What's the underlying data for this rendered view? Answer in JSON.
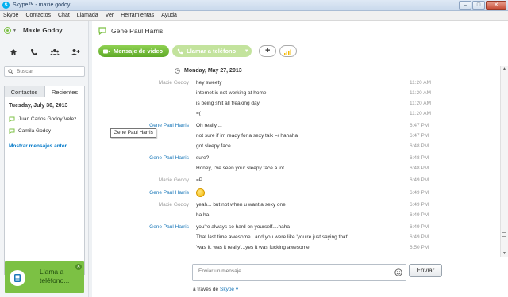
{
  "window": {
    "title": "Skype™ - maxie.godoy",
    "controls": [
      "minimize",
      "maximize",
      "close"
    ]
  },
  "menu": [
    "Skype",
    "Contactos",
    "Chat",
    "Llamada",
    "Ver",
    "Herramientas",
    "Ayuda"
  ],
  "sidebar": {
    "profile_name": "Maxie Godoy",
    "search_placeholder": "Buscar",
    "tabs": [
      {
        "label": "Contactos",
        "active": false
      },
      {
        "label": "Recientes",
        "active": true
      }
    ],
    "recent_date": "Tuesday, July 30, 2013",
    "recent_items": [
      {
        "name": "Juan Carlos Godoy Velez"
      },
      {
        "name": "Camila Godoy"
      }
    ],
    "more_link": "Mostrar mensajes anter...",
    "call_banner": {
      "label_line1": "Llama a",
      "label_line2": "teléfono..."
    }
  },
  "conversation": {
    "title": "Gene Paul Harris",
    "video_button": "Mensaje de video",
    "call_button": "Llamar a teléfono",
    "date_header": "Monday, May 27, 2013",
    "tooltip": "Gene Paul Harris",
    "messages": [
      {
        "sender": "Maxie Godoy",
        "sender_style": "gray",
        "text": "hey sweety",
        "time": "11:20 AM"
      },
      {
        "sender": "",
        "sender_style": "gray",
        "text": "internet is not working at home",
        "time": "11:20 AM"
      },
      {
        "sender": "",
        "sender_style": "gray",
        "text": "is being shit all freaking day",
        "time": "11:20 AM"
      },
      {
        "sender": "",
        "sender_style": "gray",
        "text": "=(",
        "time": "11:20 AM"
      },
      {
        "sender": "Gene Paul Harris",
        "sender_style": "blue",
        "text": "Oh really....",
        "time": "6:47 PM"
      },
      {
        "sender": "",
        "sender_style": "gray",
        "text": "not sure if im ready for a sexy talk =/ hahaha",
        "time": "6:47 PM"
      },
      {
        "sender": "",
        "sender_style": "gray",
        "text": "got sleepy face",
        "time": "6:48 PM"
      },
      {
        "sender": "Gene Paul Harris",
        "sender_style": "blue",
        "text": "sure?",
        "time": "6:48 PM"
      },
      {
        "sender": "",
        "sender_style": "gray",
        "text": "Honey, I've seen your sleepy face a lot",
        "time": "6:48 PM"
      },
      {
        "sender": "Maxie Godoy",
        "sender_style": "gray",
        "text": "=P",
        "time": "6:49 PM"
      },
      {
        "sender": "Gene Paul Harris",
        "sender_style": "blue",
        "text": "",
        "emoticon": "smile",
        "time": "6:49 PM"
      },
      {
        "sender": "Maxie Godoy",
        "sender_style": "gray",
        "text": "yeah... but not when u want a sexy one",
        "time": "6:49 PM"
      },
      {
        "sender": "",
        "sender_style": "gray",
        "text": "ha ha",
        "time": "6:49 PM"
      },
      {
        "sender": "Gene Paul Harris",
        "sender_style": "blue",
        "text": "you're always so hard on yourself....haha",
        "time": "6:49 PM"
      },
      {
        "sender": "",
        "sender_style": "gray",
        "text": "That last time awesome...and you were like 'you're just saying that'",
        "time": "6:49 PM"
      },
      {
        "sender": "",
        "sender_style": "gray",
        "text": "'was it, was it really'...yes it was fucking awesome",
        "time": "6:50 PM"
      }
    ],
    "compose_placeholder": "Enviar un mensaje",
    "send_button": "Enviar",
    "via_prefix": "a través de",
    "via_brand": "Skype"
  },
  "colors": {
    "accent_green": "#7cc144",
    "link_blue": "#1a78b9",
    "status_online": "#7cc144"
  }
}
